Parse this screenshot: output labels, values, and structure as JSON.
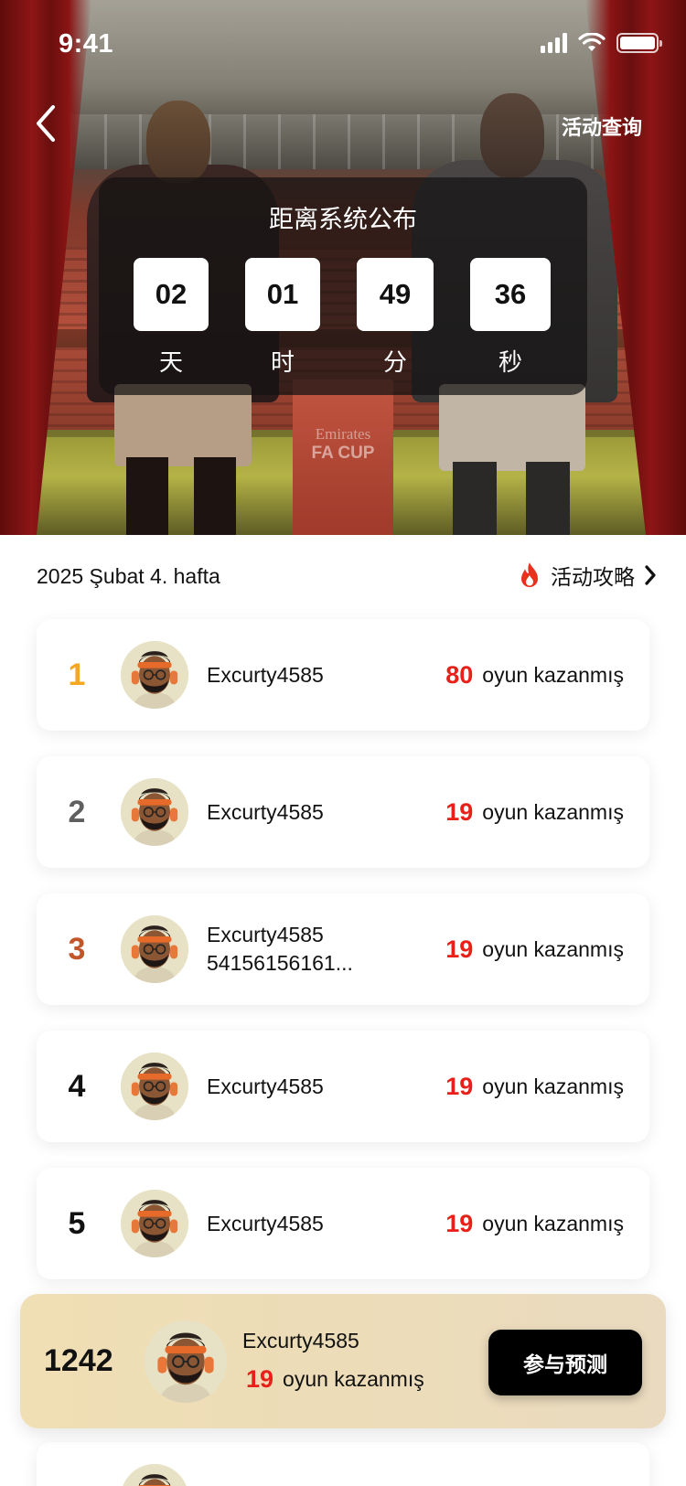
{
  "status_bar": {
    "time": "9:41"
  },
  "header": {
    "query_link": "活动查询"
  },
  "countdown": {
    "title": "距离系统公布",
    "units": [
      {
        "value": "02",
        "label": "天"
      },
      {
        "value": "01",
        "label": "时"
      },
      {
        "value": "49",
        "label": "分"
      },
      {
        "value": "36",
        "label": "秒"
      }
    ]
  },
  "hero_banner": {
    "sponsor": "Emirates",
    "cup": "FA CUP"
  },
  "week": {
    "label": "2025 Şubat 4. hafta",
    "guide_link": "活动攻略"
  },
  "leaderboard": [
    {
      "rank": "1",
      "rank_color": "#f5a623",
      "name": "Excurty4585",
      "name_line2": "",
      "wins": "80",
      "wins_label": "oyun kazanmış"
    },
    {
      "rank": "2",
      "rank_color": "#5f5f5f",
      "name": "Excurty4585",
      "name_line2": "",
      "wins": "19",
      "wins_label": "oyun kazanmış"
    },
    {
      "rank": "3",
      "rank_color": "#c2562a",
      "name": "Excurty4585",
      "name_line2": "54156156161...",
      "wins": "19",
      "wins_label": "oyun kazanmış"
    },
    {
      "rank": "4",
      "rank_color": "#111111",
      "name": "Excurty4585",
      "name_line2": "",
      "wins": "19",
      "wins_label": "oyun kazanmış"
    },
    {
      "rank": "5",
      "rank_color": "#111111",
      "name": "Excurty4585",
      "name_line2": "",
      "wins": "19",
      "wins_label": "oyun kazanmış"
    }
  ],
  "my_rank": {
    "rank": "1242",
    "name": "Excurty4585",
    "wins": "19",
    "wins_label": "oyun kazanmış",
    "button": "参与预测"
  },
  "colors": {
    "accent_red": "#e8201a",
    "gold": "#f5a623",
    "bronze": "#c2562a",
    "silver": "#5f5f5f",
    "fire_icon": "#e8321e"
  },
  "icons": [
    "back-chevron-icon",
    "signal-icon",
    "wifi-icon",
    "battery-icon",
    "fire-icon",
    "chevron-right-icon",
    "avatar-icon"
  ]
}
